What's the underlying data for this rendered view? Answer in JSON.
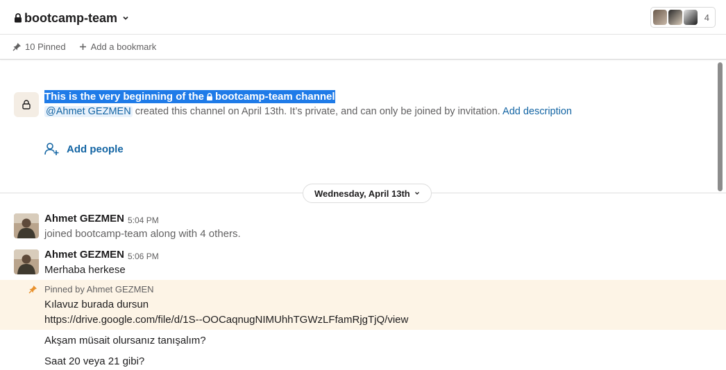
{
  "header": {
    "channel_name": "bootcamp-team",
    "member_count": "4"
  },
  "bookmarks": {
    "pinned": "10 Pinned",
    "add_bookmark": "Add a bookmark"
  },
  "intro": {
    "title_prefix": "This is the very beginning of the",
    "title_channel": "bootcamp-team channel",
    "mention": "@Ahmet GEZMEN",
    "desc": " created this channel on April 13th. It’s private, and can only be joined by invitation. ",
    "add_description": "Add description",
    "add_people": "Add people"
  },
  "date_divider": "Wednesday, April 13th",
  "messages": [
    {
      "sender": "Ahmet GEZMEN",
      "time": "5:04 PM",
      "text": "joined bootcamp-team along with 4 others."
    },
    {
      "sender": "Ahmet GEZMEN",
      "time": "5:06 PM",
      "text": "Merhaba herkese"
    }
  ],
  "pinned": {
    "label": "Pinned by Ahmet GEZMEN",
    "text": "Kılavuz burada dursun",
    "link": "https://drive.google.com/file/d/1S--OOCaqnugNIMUhhTGWzLFfamRjgTjQ/view"
  },
  "followups": [
    "Akşam müsait olursanız tanışalım?",
    "Saat 20 veya 21 gibi?"
  ],
  "colors": {
    "link": "#1264a3",
    "selection": "#1f7be8",
    "pinned_bg": "#fdf4e6",
    "pin_icon": "#e8912d"
  }
}
